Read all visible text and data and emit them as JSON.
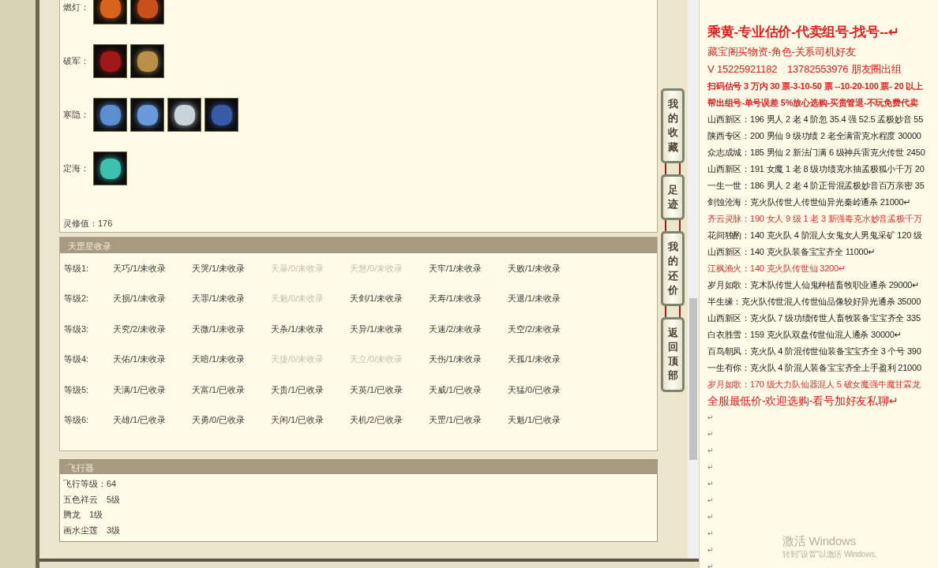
{
  "equipment": {
    "groups": [
      {
        "label": "燃灯：",
        "items": [
          {
            "color": "#d8641c"
          },
          {
            "color": "#c8501a"
          }
        ]
      },
      {
        "label": "破军：",
        "items": [
          {
            "color": "#a01818"
          },
          {
            "color": "#b8904a"
          }
        ]
      },
      {
        "label": "寒隐：",
        "items": [
          {
            "color": "#5a8ed0"
          },
          {
            "color": "#6a98d8"
          },
          {
            "color": "#c8d4dc"
          },
          {
            "color": "#3a5aa8"
          }
        ]
      },
      {
        "label": "定海：",
        "items": [
          {
            "color": "#3cc0b0"
          }
        ]
      }
    ],
    "spirit": "灵修值：176"
  },
  "collection": {
    "title": "天罡星收录",
    "rows": [
      {
        "label": "等级1:",
        "cells": [
          {
            "text": "天巧/1/未收录",
            "dimmed": false
          },
          {
            "text": "天哭/1/未收录",
            "dimmed": false
          },
          {
            "text": "天暴/0/未收录",
            "dimmed": true
          },
          {
            "text": "天慧/0/未收录",
            "dimmed": true
          },
          {
            "text": "天牢/1/未收录",
            "dimmed": false
          },
          {
            "text": "天败/1/未收录",
            "dimmed": false
          }
        ]
      },
      {
        "label": "等级2:",
        "cells": [
          {
            "text": "天损/1/未收录",
            "dimmed": false
          },
          {
            "text": "天罪/1/未收录",
            "dimmed": false
          },
          {
            "text": "天魁/0/未收录",
            "dimmed": true
          },
          {
            "text": "天剑/1/未收录",
            "dimmed": false
          },
          {
            "text": "天寿/1/未收录",
            "dimmed": false
          },
          {
            "text": "天退/1/未收录",
            "dimmed": false
          }
        ]
      },
      {
        "label": "等级3:",
        "cells": [
          {
            "text": "天究/2/未收录",
            "dimmed": false
          },
          {
            "text": "天微/1/未收录",
            "dimmed": false
          },
          {
            "text": "天杀/1/未收录",
            "dimmed": false
          },
          {
            "text": "天异/1/未收录",
            "dimmed": false
          },
          {
            "text": "天速/2/未收录",
            "dimmed": false
          },
          {
            "text": "天空/2/未收录",
            "dimmed": false
          }
        ]
      },
      {
        "label": "等级4:",
        "cells": [
          {
            "text": "天佑/1/未收录",
            "dimmed": false
          },
          {
            "text": "天暗/1/未收录",
            "dimmed": false
          },
          {
            "text": "天捷/0/未收录",
            "dimmed": true
          },
          {
            "text": "天立/0/未收录",
            "dimmed": true
          },
          {
            "text": "天伤/1/未收录",
            "dimmed": false
          },
          {
            "text": "天孤/1/未收录",
            "dimmed": false
          }
        ]
      },
      {
        "label": "等级5:",
        "cells": [
          {
            "text": "天满/1/已收录",
            "dimmed": false
          },
          {
            "text": "天富/1/已收录",
            "dimmed": false
          },
          {
            "text": "天贵/1/已收录",
            "dimmed": false
          },
          {
            "text": "天英/1/已收录",
            "dimmed": false
          },
          {
            "text": "天威/1/已收录",
            "dimmed": false
          },
          {
            "text": "天猛/0/已收录",
            "dimmed": false
          }
        ]
      },
      {
        "label": "等级6:",
        "cells": [
          {
            "text": "天雄/1/已收录",
            "dimmed": false
          },
          {
            "text": "天勇/0/已收录",
            "dimmed": false
          },
          {
            "text": "天闲/1/已收录",
            "dimmed": false
          },
          {
            "text": "天机/2/已收录",
            "dimmed": false
          },
          {
            "text": "天罡/1/已收录",
            "dimmed": false
          },
          {
            "text": "天魁/1/已收录",
            "dimmed": false
          }
        ]
      }
    ]
  },
  "flyer": {
    "title": "飞行器",
    "lines": [
      "飞行等级：64",
      "五色祥云　5级",
      "腾龙　1级",
      "画水尘莲　3级"
    ]
  },
  "side_tabs": [
    "我的收藏",
    "足迹",
    "我的还价",
    "返回顶部"
  ],
  "notes": {
    "lines": [
      {
        "kind": "headline",
        "text": "乘黄-专业估价-代卖组号-找号--↵"
      },
      {
        "kind": "contact",
        "text": "藏宝阁买物资-角色-关系司机好友"
      },
      {
        "kind": "contact",
        "text": "V 15225921182　13782553976 朋友圈出组"
      },
      {
        "kind": "notice",
        "text": "扫码估号 3 万内 30 票-3-10-50 票 --10-20-100 票- 20 以上"
      },
      {
        "kind": "notice",
        "text": "帮出组号-单号误差 5%放心选购-买贵管退-不玩免费代卖"
      },
      {
        "kind": "listing",
        "text": "山西新区：196 男人 2 老 4 阶忽 35.4 强 52.5 孟极妙音 55"
      },
      {
        "kind": "listing",
        "text": "陕西专区：200 男仙 9 级功绩 2 老全满雷克水程度 30000"
      },
      {
        "kind": "listing",
        "text": "众志成城：185 男仙 2 新法门满 6 级神兵雷克火传世 2450"
      },
      {
        "kind": "listing",
        "text": "山西新区：191 女魔 1 老 8 级功绩克水抽孟极狐小千万 20"
      },
      {
        "kind": "listing",
        "text": "一生一世：186 男人 2 老 4 阶正骨混孟极妙音百万亲密 35"
      },
      {
        "kind": "listing",
        "text": "剑蚀沧海：克火队传世人传世仙异光秦岭通杀 21000↵"
      },
      {
        "kind": "highlight",
        "text": "齐云灵脉：190 女人 9 级 1 老 3 新强毒克水妙音孟极千万"
      },
      {
        "kind": "listing",
        "text": "花间独酌：140 克火队 4 阶混人女鬼女人男鬼采矿 120 级"
      },
      {
        "kind": "listing",
        "text": "山西新区：140 克火队装备宝宝齐全 11000↵"
      },
      {
        "kind": "highlight",
        "text": "江枫渔火：140 克火队传世仙 3200↵"
      },
      {
        "kind": "listing",
        "text": "岁月如歌：克木队传世人仙鬼种植畜牧职业通杀 29000↵"
      },
      {
        "kind": "listing",
        "text": "半生缘：克火队传世混人传世仙品像较好异光通杀 35000"
      },
      {
        "kind": "listing",
        "text": "山西新区：克火队 7 级功绩传世人畜牧装备宝宝齐全 335"
      },
      {
        "kind": "listing",
        "text": "白衣胜雪：159 克火队双盘传世仙混人通杀 30000↵"
      },
      {
        "kind": "listing",
        "text": "百鸟朝凤：克火队 4 阶混传世仙装备宝宝齐全 3 个号 390"
      },
      {
        "kind": "listing",
        "text": "一生有你：克火队 4 阶混人装备宝宝齐全上手盈利 21000"
      },
      {
        "kind": "highlight",
        "text": "岁月如歌：170 级大力队仙器混人 5 破女魔强牛魔甘霖龙"
      },
      {
        "kind": "closing",
        "text": "全服最低价-欢迎选购-看号加好友私聊↵"
      },
      {
        "kind": "blank",
        "text": "↵"
      },
      {
        "kind": "blank",
        "text": "↵"
      },
      {
        "kind": "blank",
        "text": "↵"
      },
      {
        "kind": "blank",
        "text": "↵"
      },
      {
        "kind": "blank",
        "text": "↵"
      },
      {
        "kind": "blank",
        "text": "↵"
      },
      {
        "kind": "blank",
        "text": "↵"
      },
      {
        "kind": "blank",
        "text": "↵"
      },
      {
        "kind": "blank",
        "text": "↵"
      },
      {
        "kind": "blank",
        "text": "↵"
      }
    ],
    "os_notice": {
      "title": "激活 Windows",
      "hint": "转到\"设置\"以激活 Windows。"
    }
  }
}
